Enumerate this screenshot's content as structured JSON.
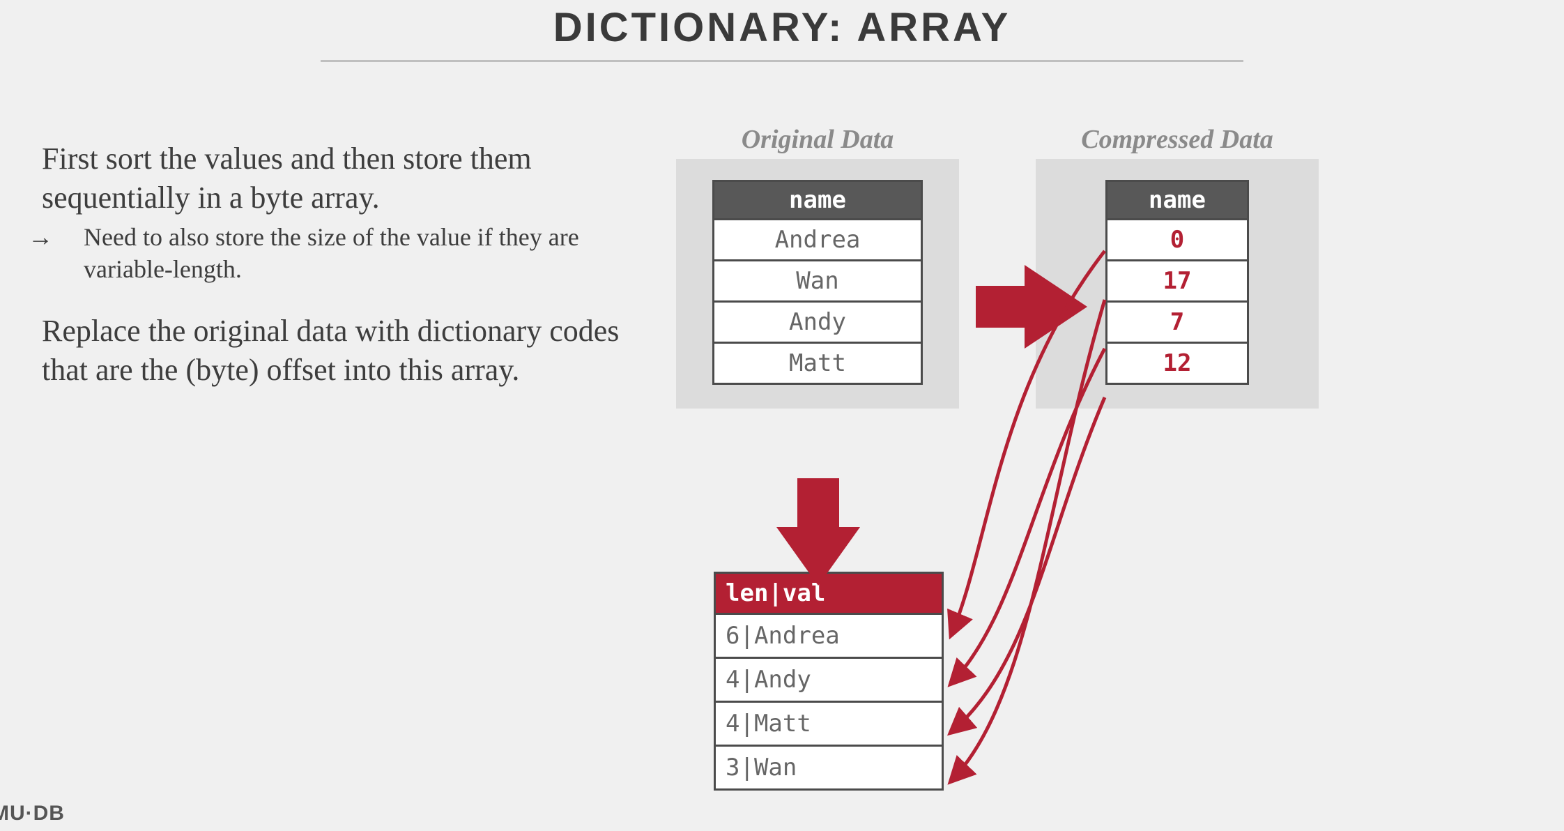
{
  "slide": {
    "title": "DICTIONARY: ARRAY",
    "paragraph1": "First sort the values and then store them sequentially in a byte array.",
    "subpoint_arrow": "→",
    "subpoint": "Need to also store the size of the value if they are variable-length.",
    "paragraph2": "Replace the original data with dictionary codes that are the (byte) offset into this array.",
    "footer": "MU·DB"
  },
  "original": {
    "label": "Original Data",
    "header": "name",
    "rows": [
      "Andrea",
      "Wan",
      "Andy",
      "Matt"
    ]
  },
  "compressed": {
    "label": "Compressed Data",
    "header": "name",
    "rows": [
      "0",
      "17",
      "7",
      "12"
    ]
  },
  "dictionary": {
    "header": "len|val",
    "rows": [
      "6|Andrea",
      "4|Andy",
      "4|Matt",
      "3|Wan"
    ]
  },
  "colors": {
    "accent": "#b32033",
    "panel": "#dcdcdc",
    "header_grey": "#585858"
  }
}
